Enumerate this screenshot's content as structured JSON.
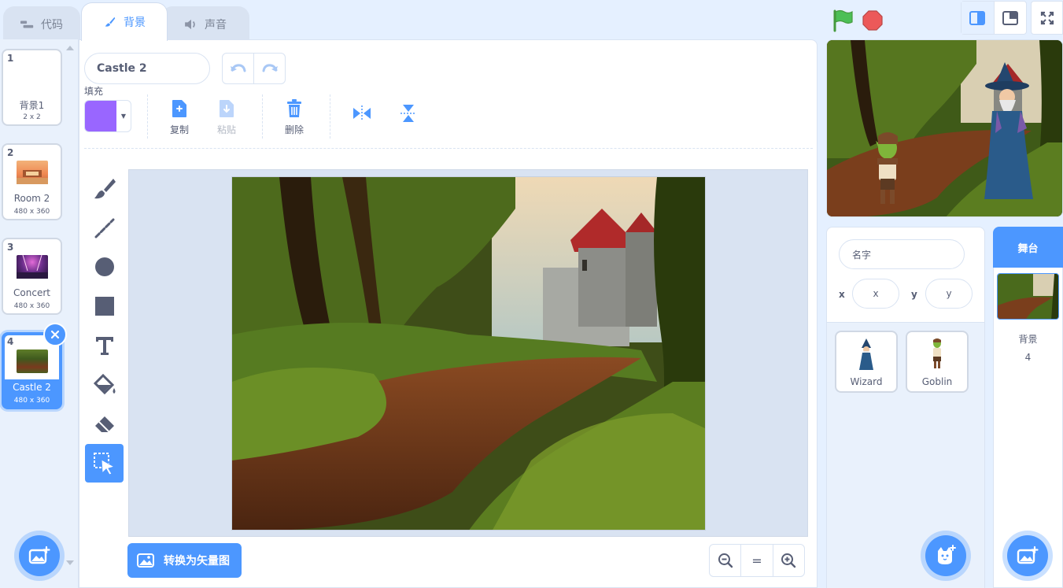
{
  "tabs": [
    {
      "label": "代码",
      "icon": "code-icon"
    },
    {
      "label": "背景",
      "icon": "brush-icon",
      "active": true
    },
    {
      "label": "声音",
      "icon": "speaker-icon"
    }
  ],
  "costumes": [
    {
      "num": "1",
      "name": "背景1",
      "size": "2 x 2",
      "thumb": "blank"
    },
    {
      "num": "2",
      "name": "Room 2",
      "size": "480 x 360",
      "thumb": "room"
    },
    {
      "num": "3",
      "name": "Concert",
      "size": "480 x 360",
      "thumb": "concert"
    },
    {
      "num": "4",
      "name": "Castle 2",
      "size": "480 x 360",
      "thumb": "castle",
      "selected": true
    }
  ],
  "editor": {
    "costume_name": "Castle 2",
    "fill_label": "填充",
    "fill_color": "#9966ff",
    "copy_label": "复制",
    "paste_label": "粘贴",
    "delete_label": "删除",
    "convert_label": "转换为矢量图",
    "tools": [
      "brush-icon",
      "line-icon",
      "circle-icon",
      "rectangle-icon",
      "text-icon",
      "fill-icon",
      "eraser-icon",
      "select-icon"
    ],
    "active_tool": "select-icon",
    "zoom_reset_label": "="
  },
  "sprite_info": {
    "name_placeholder": "名字",
    "x_label": "x",
    "x_placeholder": "x",
    "y_label": "y",
    "y_placeholder": "y"
  },
  "sprites": [
    {
      "name": "Wizard"
    },
    {
      "name": "Goblin"
    }
  ],
  "stage_pane": {
    "header": "舞台",
    "backdrops_label": "背景",
    "backdrops_count": "4"
  },
  "colors": {
    "accent": "#4c97ff",
    "background": "#e5f0ff",
    "text": "#575e75",
    "border": "#d9e3f2"
  }
}
